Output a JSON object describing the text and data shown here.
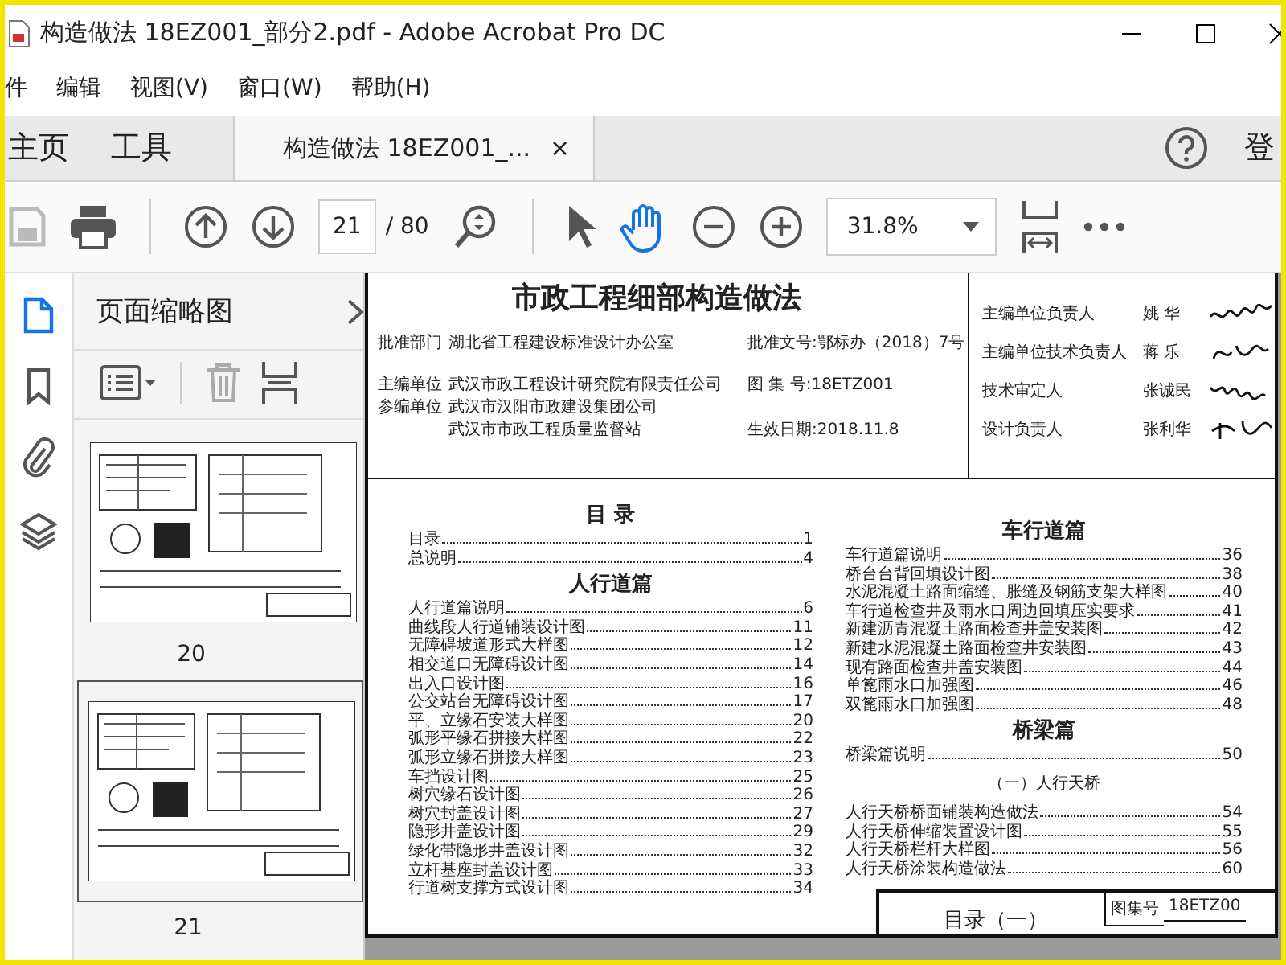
{
  "window": {
    "title": "构造做法 18EZ001_部分2.pdf - Adobe Acrobat Pro DC"
  },
  "menu": [
    "件",
    "编辑",
    "视图(V)",
    "窗口(W)",
    "帮助(H)"
  ],
  "nav_tabs": [
    {
      "label": "主页",
      "selected": false
    },
    {
      "label": "工具",
      "selected": false
    }
  ],
  "document_tab": {
    "label": "构造做法 18EZ001_...",
    "close": "×",
    "selected": true
  },
  "sign_in": "登",
  "toolbar": {
    "page": "21",
    "page_total": "/ 80",
    "zoom": "31.8%",
    "hand_tool_on": true
  },
  "side_rail": [
    {
      "kind": "pages",
      "selected": true
    },
    {
      "kind": "bookmarks",
      "selected": false
    },
    {
      "kind": "attachments",
      "selected": false
    },
    {
      "kind": "layers",
      "selected": false
    }
  ],
  "thumbnails_panel": {
    "title": "页面缩略图",
    "thumbnails": [
      {
        "label": "20",
        "selected": false
      },
      {
        "label": "21",
        "selected": true
      }
    ]
  },
  "page": {
    "title": "市政工程细部构造做法",
    "header_rows": [
      {
        "label": "批准部门",
        "value": "湖北省工程建设标准设计办公室",
        "extra": "批准文号:鄂标办（2018）7号"
      },
      {
        "label": "主编单位",
        "value": "武汉市政工程设计研究院有限责任公司",
        "extra": "图 集 号:18ETZ001"
      },
      {
        "label": "参编单位",
        "value": "武汉市汉阳市政建设集团公司"
      },
      {
        "value": "武汉市市政工程质量监督站",
        "extra": "生效日期:2018.11.8"
      }
    ],
    "responsible": [
      {
        "role": "主编单位负责人",
        "name": "姚 华"
      },
      {
        "role": "主编单位技术负责人",
        "name": "蒋 乐"
      },
      {
        "role": "技术审定人",
        "name": "张诚民"
      },
      {
        "role": "设计负责人",
        "name": "张利华"
      }
    ],
    "toc_left": [
      {
        "kind": "heading",
        "text": "目 录"
      },
      {
        "kind": "entry",
        "text": "目录",
        "page": "1"
      },
      {
        "kind": "entry",
        "text": "总说明",
        "page": "4"
      },
      {
        "kind": "heading",
        "text": "人行道篇"
      },
      {
        "kind": "entry",
        "text": "人行道篇说明",
        "page": "6"
      },
      {
        "kind": "entry",
        "text": "曲线段人行道铺装设计图",
        "page": "11"
      },
      {
        "kind": "entry",
        "text": "无障碍坡道形式大样图",
        "page": "12"
      },
      {
        "kind": "entry",
        "text": "相交道口无障碍设计图",
        "page": "14"
      },
      {
        "kind": "entry",
        "text": "出入口设计图",
        "page": "16"
      },
      {
        "kind": "entry",
        "text": "公交站台无障碍设计图",
        "page": "17"
      },
      {
        "kind": "entry",
        "text": "平、立缘石安装大样图",
        "page": "20"
      },
      {
        "kind": "entry",
        "text": "弧形平缘石拼接大样图",
        "page": "22"
      },
      {
        "kind": "entry",
        "text": "弧形立缘石拼接大样图",
        "page": "23"
      },
      {
        "kind": "entry",
        "text": "车挡设计图",
        "page": "25"
      },
      {
        "kind": "entry",
        "text": "树穴缘石设计图",
        "page": "26"
      },
      {
        "kind": "entry",
        "text": "树穴封盖设计图",
        "page": "27"
      },
      {
        "kind": "entry",
        "text": "隐形井盖设计图",
        "page": "29"
      },
      {
        "kind": "entry",
        "text": "绿化带隐形井盖设计图",
        "page": "32"
      },
      {
        "kind": "entry",
        "text": "立杆基座封盖设计图",
        "page": "33"
      },
      {
        "kind": "entry",
        "text": "行道树支撑方式设计图",
        "page": "34"
      }
    ],
    "toc_right": [
      {
        "kind": "heading",
        "text": "车行道篇"
      },
      {
        "kind": "entry",
        "text": "车行道篇说明",
        "page": "36"
      },
      {
        "kind": "entry",
        "text": "桥台台背回填设计图",
        "page": "38"
      },
      {
        "kind": "entry",
        "text": "水泥混凝土路面缩缝、胀缝及钢筋支架大样图",
        "page": "40"
      },
      {
        "kind": "entry",
        "text": "车行道检查井及雨水口周边回填压实要求",
        "page": "41"
      },
      {
        "kind": "entry",
        "text": "新建沥青混凝土路面检查井盖安装图",
        "page": "42"
      },
      {
        "kind": "entry",
        "text": "新建水泥混凝土路面检查井安装图",
        "page": "43"
      },
      {
        "kind": "entry",
        "text": "现有路面检查井盖安装图",
        "page": "44"
      },
      {
        "kind": "entry",
        "text": "单篦雨水口加强图",
        "page": "46"
      },
      {
        "kind": "entry",
        "text": "双篦雨水口加强图",
        "page": "48"
      },
      {
        "kind": "heading",
        "text": "桥梁篇"
      },
      {
        "kind": "entry",
        "text": "桥梁篇说明",
        "page": "50"
      },
      {
        "kind": "subheading",
        "text": "（一）人行天桥"
      },
      {
        "kind": "entry",
        "text": "人行天桥桥面铺装构造做法",
        "page": "54"
      },
      {
        "kind": "entry",
        "text": "人行天桥伸缩装置设计图",
        "page": "55"
      },
      {
        "kind": "entry",
        "text": "人行天桥栏杆大样图",
        "page": "56"
      },
      {
        "kind": "entry",
        "text": "人行天桥涂装构造做法",
        "page": "60"
      }
    ],
    "title_block": {
      "title": "目录（一）",
      "set_label": "图集号",
      "set_number": "18ETZ00"
    }
  }
}
